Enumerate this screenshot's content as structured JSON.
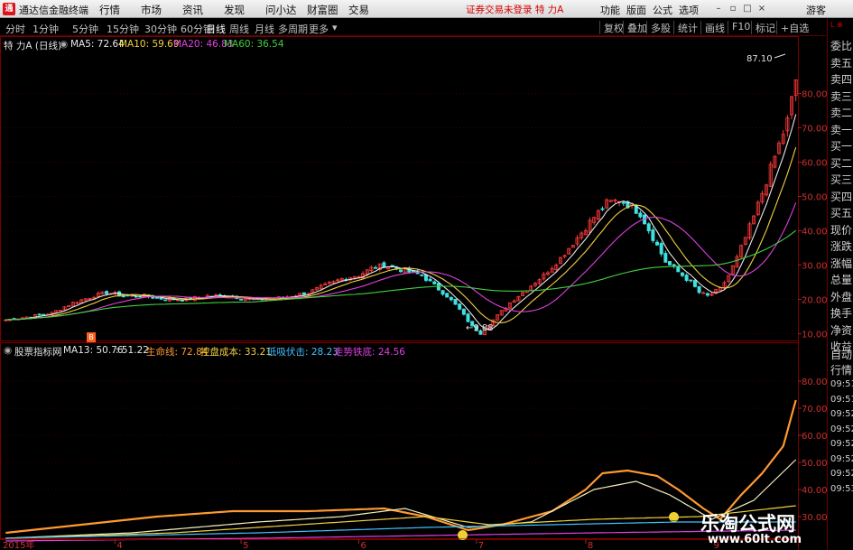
{
  "app": {
    "name": "通达信金融终端",
    "menus": [
      "行情",
      "市场",
      "资讯",
      "发现",
      "问小达",
      "财富圈",
      "交易"
    ],
    "status": "证券交易未登录 特 力A",
    "right_menus": [
      "功能",
      "版面",
      "公式",
      "选项"
    ],
    "guest": "游客"
  },
  "toolbar": {
    "timeframes": [
      "分时",
      "1分钟",
      "5分钟",
      "15分钟",
      "30分钟",
      "60分钟",
      "日线",
      "周线",
      "月线",
      "多周期",
      "更多"
    ],
    "active": "日线",
    "right_tools": [
      "复权",
      "叠加",
      "多股",
      "统计",
      "画线",
      "F10",
      "标记",
      "+自选"
    ]
  },
  "right_panel": {
    "top_labels": [
      "委比",
      "卖五",
      "卖四",
      "卖三",
      "卖二",
      "卖一",
      "买一",
      "买二",
      "买三",
      "买四",
      "买五",
      "现价",
      "涨跌",
      "涨幅",
      "总量",
      "外盘",
      "换手",
      "净资",
      "收益"
    ],
    "bottom_labels": [
      "自动",
      "行情",
      "09:51",
      "09:51",
      "09:52",
      "09:52",
      "09:52",
      "09:52",
      "09:52",
      "09:53"
    ]
  },
  "upper_pane": {
    "title": "特 力A (日线)",
    "indicators": [
      {
        "label": "MA5: 72.64",
        "color": "#e8e8e8"
      },
      {
        "label": "MA10: 59.69",
        "color": "#f0d040"
      },
      {
        "label": "MA20: 46.83",
        "color": "#e040e0"
      },
      {
        "label": "MA60: 36.54",
        "color": "#40d040"
      }
    ],
    "y_ticks": [
      10,
      20,
      30,
      40,
      50,
      60,
      70,
      80
    ],
    "annotations": {
      "high": "87.10",
      "low": "9.88"
    }
  },
  "lower_pane": {
    "title": "股票指标网",
    "indicators": [
      {
        "label": "MA13: 50.76",
        "color": "#e8e8e8"
      },
      {
        "label": ": 51.22",
        "color": "#e8e8e8"
      },
      {
        "label": "生命线: 72.84",
        "color": "#ff9a30"
      },
      {
        "label": "控盘成本: 33.21",
        "color": "#f0d040"
      },
      {
        "label": "低吸伏击: 28.23",
        "color": "#40c0ff"
      },
      {
        "label": "走势铁底: 24.56",
        "color": "#e040e0"
      }
    ],
    "y_ticks": [
      30,
      40,
      50,
      60,
      70,
      80
    ]
  },
  "x_axis": {
    "labels": [
      "2015年",
      "4",
      "5",
      "6",
      "7",
      "8",
      "9"
    ]
  },
  "watermark": {
    "title": "乐淘公式网",
    "url": "www.60lt.com"
  },
  "chart_data": {
    "type": "candlestick",
    "x_labels": [
      "2015年",
      "4",
      "5",
      "6",
      "7",
      "8",
      "9"
    ],
    "upper": {
      "ylim": [
        8,
        92
      ],
      "y_ticks": [
        10,
        20,
        30,
        40,
        50,
        60,
        70,
        80
      ],
      "close_anchors": [
        [
          0,
          14
        ],
        [
          6,
          15
        ],
        [
          11,
          16
        ],
        [
          16,
          19
        ],
        [
          21,
          21
        ],
        [
          24,
          22
        ],
        [
          28,
          21
        ],
        [
          33,
          21
        ],
        [
          38,
          20
        ],
        [
          43,
          20
        ],
        [
          48,
          21
        ],
        [
          53,
          21
        ],
        [
          58,
          20
        ],
        [
          63,
          20
        ],
        [
          68,
          21
        ],
        [
          72,
          22
        ],
        [
          76,
          24
        ],
        [
          80,
          26
        ],
        [
          84,
          27
        ],
        [
          87,
          29
        ],
        [
          90,
          30
        ],
        [
          93,
          29
        ],
        [
          96,
          28
        ],
        [
          99,
          27
        ],
        [
          102,
          24
        ],
        [
          105,
          21
        ],
        [
          108,
          17
        ],
        [
          111,
          12
        ],
        [
          113,
          10
        ],
        [
          116,
          14
        ],
        [
          120,
          19
        ],
        [
          124,
          23
        ],
        [
          128,
          27
        ],
        [
          132,
          32
        ],
        [
          136,
          38
        ],
        [
          140,
          44
        ],
        [
          143,
          48
        ],
        [
          146,
          49
        ],
        [
          149,
          47
        ],
        [
          151,
          45
        ],
        [
          154,
          38
        ],
        [
          157,
          31
        ],
        [
          160,
          28
        ],
        [
          163,
          25
        ],
        [
          165,
          22
        ],
        [
          167,
          21
        ],
        [
          170,
          23
        ],
        [
          172,
          27
        ],
        [
          174,
          32
        ],
        [
          176,
          38
        ],
        [
          178,
          44
        ],
        [
          180,
          51
        ],
        [
          182,
          58
        ],
        [
          184,
          65
        ],
        [
          186,
          72
        ],
        [
          187,
          78
        ],
        [
          188,
          84
        ]
      ],
      "ma_periods": [
        5,
        10,
        20,
        60
      ]
    },
    "lower": {
      "ylim": [
        22,
        88
      ],
      "y_ticks": [
        30,
        40,
        50,
        60,
        70,
        80
      ],
      "series": [
        {
          "name": "生命线",
          "anchors": [
            [
              0,
              24
            ],
            [
              18,
              27
            ],
            [
              36,
              30
            ],
            [
              54,
              32
            ],
            [
              72,
              32
            ],
            [
              90,
              33
            ],
            [
              100,
              30
            ],
            [
              110,
              25
            ],
            [
              118,
              27
            ],
            [
              130,
              32
            ],
            [
              138,
              40
            ],
            [
              142,
              46
            ],
            [
              148,
              47
            ],
            [
              155,
              45
            ],
            [
              160,
              40
            ],
            [
              166,
              33
            ],
            [
              170,
              29
            ],
            [
              175,
              38
            ],
            [
              180,
              46
            ],
            [
              185,
              56
            ],
            [
              188,
              73
            ]
          ]
        },
        {
          "name": "MA13",
          "anchors": [
            [
              0,
              22
            ],
            [
              30,
              24
            ],
            [
              60,
              28
            ],
            [
              80,
              30
            ],
            [
              95,
              33
            ],
            [
              110,
              26
            ],
            [
              125,
              28
            ],
            [
              140,
              40
            ],
            [
              150,
              43
            ],
            [
              158,
              38
            ],
            [
              168,
              29
            ],
            [
              178,
              36
            ],
            [
              188,
              51
            ]
          ]
        },
        {
          "name": "控盘成本",
          "anchors": [
            [
              0,
              22
            ],
            [
              40,
              24
            ],
            [
              80,
              28
            ],
            [
              100,
              30
            ],
            [
              115,
              27
            ],
            [
              140,
              29
            ],
            [
              165,
              30
            ],
            [
              188,
              34
            ]
          ]
        },
        {
          "name": "低吸伏击",
          "anchors": [
            [
              0,
              22
            ],
            [
              60,
              24
            ],
            [
              100,
              26
            ],
            [
              130,
              27
            ],
            [
              160,
              28
            ],
            [
              188,
              28
            ]
          ]
        },
        {
          "name": "走势铁底",
          "anchors": [
            [
              0,
              21
            ],
            [
              60,
              22
            ],
            [
              100,
              23
            ],
            [
              140,
              24
            ],
            [
              188,
              25
            ]
          ]
        }
      ]
    }
  }
}
